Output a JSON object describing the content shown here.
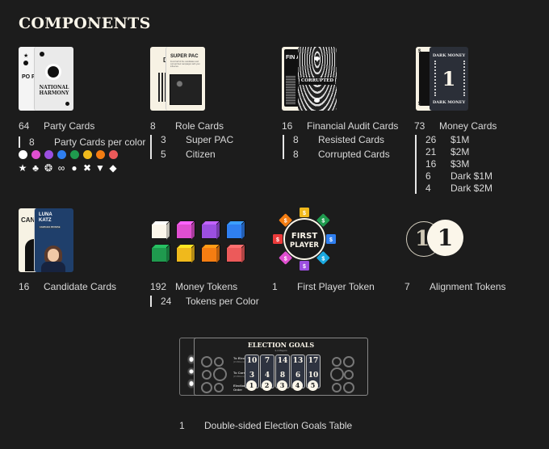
{
  "page_title": "COMPONENTS",
  "sections": {
    "party_cards": {
      "count": "64",
      "label": "Party Cards",
      "sub": [
        {
          "count": "8",
          "label": "Party Cards per color"
        }
      ],
      "card_texts": {
        "back": "PO PA",
        "front": "NATIONAL HARMONY"
      },
      "colors": [
        "#ffffff",
        "#e04fd0",
        "#9b4fe0",
        "#2f7ff0",
        "#1f9a4e",
        "#f0b91c",
        "#f47d12",
        "#ec5a5a"
      ],
      "symbols": [
        "star-icon",
        "clover-icon",
        "shell-icon",
        "infinity-icon",
        "circle-icon",
        "x-icon",
        "triangle-down-icon",
        "diamond-icon"
      ],
      "symbol_glyphs": [
        "★",
        "♣",
        "❂",
        "∞",
        "●",
        "✖",
        "▼",
        "◆"
      ]
    },
    "role_cards": {
      "count": "8",
      "label": "Role Cards",
      "sub": [
        {
          "count": "3",
          "label": "Super PAC"
        },
        {
          "count": "5",
          "label": "Citizen"
        }
      ],
      "card_texts": {
        "back": "DO CI",
        "front_title": "SUPER PAC",
        "front_body": "Fund half of the candidates and corrupt their campaigns with your influence"
      }
    },
    "audit_cards": {
      "count": "16",
      "label": "Financial Audit Cards",
      "sub": [
        {
          "count": "8",
          "label": "Resisted Cards"
        },
        {
          "count": "8",
          "label": "Corrupted Cards"
        }
      ],
      "card_texts": {
        "back": "FIN AU",
        "front": "CORRUPTED"
      }
    },
    "money_cards": {
      "count": "73",
      "label": "Money Cards",
      "sub": [
        {
          "count": "26",
          "label": "$1M"
        },
        {
          "count": "21",
          "label": "$2M"
        },
        {
          "count": "16",
          "label": "$3M"
        },
        {
          "count": "6",
          "label": "Dark $1M"
        },
        {
          "count": "4",
          "label": "Dark $2M"
        }
      ],
      "card_texts": {
        "title": "DARK MONEY",
        "value": "1",
        "corner": "$"
      }
    },
    "candidate_cards": {
      "count": "16",
      "label": "Candidate Cards",
      "card_texts": {
        "back": "CAN CA",
        "name": "LUNA KATZ",
        "subtitle": "CAMPAIGN PROMISE"
      }
    },
    "money_tokens": {
      "count": "192",
      "label": "Money Tokens",
      "sub": [
        {
          "count": "24",
          "label": "Tokens per Color"
        }
      ],
      "colors": [
        "#fbf6ea",
        "#e04fd0",
        "#9b4fe0",
        "#2f7ff0",
        "#1f9a4e",
        "#f0b91c",
        "#f47d12",
        "#ec5a5a"
      ]
    },
    "first_player": {
      "count": "1",
      "label": "First Player Token",
      "token_text": [
        "FIRST",
        "PLAYER"
      ],
      "segment_colors": [
        "#f0b91c",
        "#1f9a4e",
        "#2f7ff0",
        "#1aa9e0",
        "#9b4fe0",
        "#e04fd0",
        "#ec3a3a",
        "#f47d12"
      ]
    },
    "alignment": {
      "count": "7",
      "label": "Alignment Tokens",
      "token_value": "1"
    },
    "election_goals": {
      "count": "1",
      "label": "Double-sided Election Goals Table",
      "table_title": "ELECTION GOALS",
      "table_subtitle": "3-4 Players",
      "row_labels": [
        "To Elect",
        "To Corrupt",
        "Election Order"
      ],
      "row_sublabels": [
        "(# Millions)",
        "(# Millions)",
        ""
      ],
      "to_elect": [
        "10",
        "7",
        "14",
        "13",
        "17"
      ],
      "to_corrupt": [
        "3",
        "4",
        "8",
        "6",
        "10"
      ],
      "order": [
        "1",
        "2",
        "3",
        "4",
        "5"
      ]
    }
  }
}
